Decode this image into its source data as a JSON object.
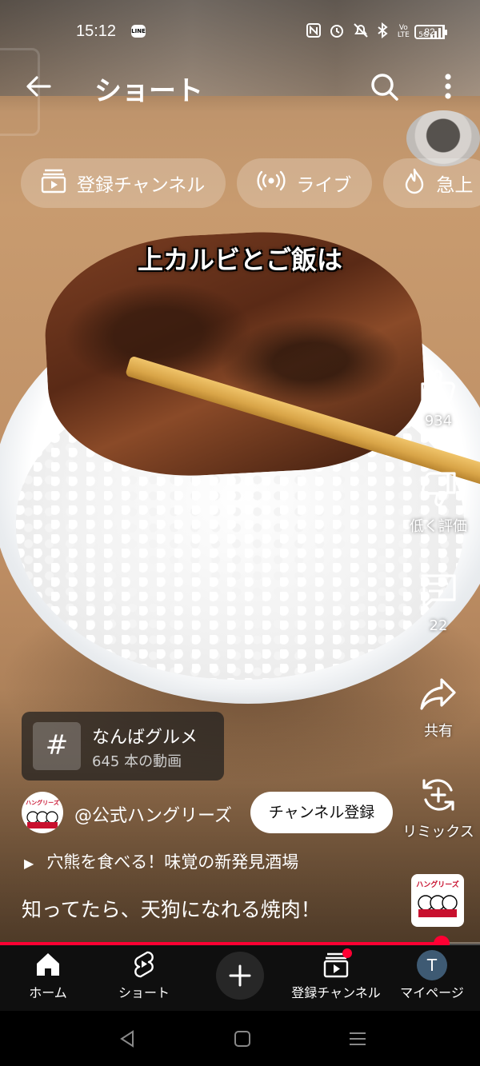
{
  "status_bar": {
    "time": "15:12",
    "line_badge": "LINE",
    "network_labels": [
      "Vo LTE",
      "5G"
    ],
    "battery": "82"
  },
  "header": {
    "title": "ショート"
  },
  "chips": [
    {
      "label": "登録チャンネル",
      "icon": "subscriptions-icon"
    },
    {
      "label": "ライブ",
      "icon": "live-icon"
    },
    {
      "label": "急上",
      "icon": "trending-icon"
    }
  ],
  "video": {
    "caption": "上カルビとご飯は"
  },
  "actions": {
    "like_count": "934",
    "dislike_label": "低く評価",
    "comment_count": "22",
    "share_label": "共有",
    "remix_label": "リミックス"
  },
  "hashtag": {
    "symbol": "#",
    "title": "なんばグルメ",
    "subtitle": "645 本の動画"
  },
  "channel": {
    "handle": "@公式ハングリーズ",
    "subscribe_label": "チャンネル登録",
    "logo_text": "ハングリーズ"
  },
  "linked_video": "穴熊を食べる！味覚の新発見酒場",
  "description": "知ってたら、天狗になれる焼肉！",
  "progress": 0.92,
  "bottom_nav": {
    "home": "ホーム",
    "shorts": "ショート",
    "subscriptions": "登録チャンネル",
    "mypage": "マイページ",
    "avatar_initial": "T"
  },
  "colors": {
    "accent": "#ff0033",
    "nav_bg": "#0f0f0f"
  }
}
